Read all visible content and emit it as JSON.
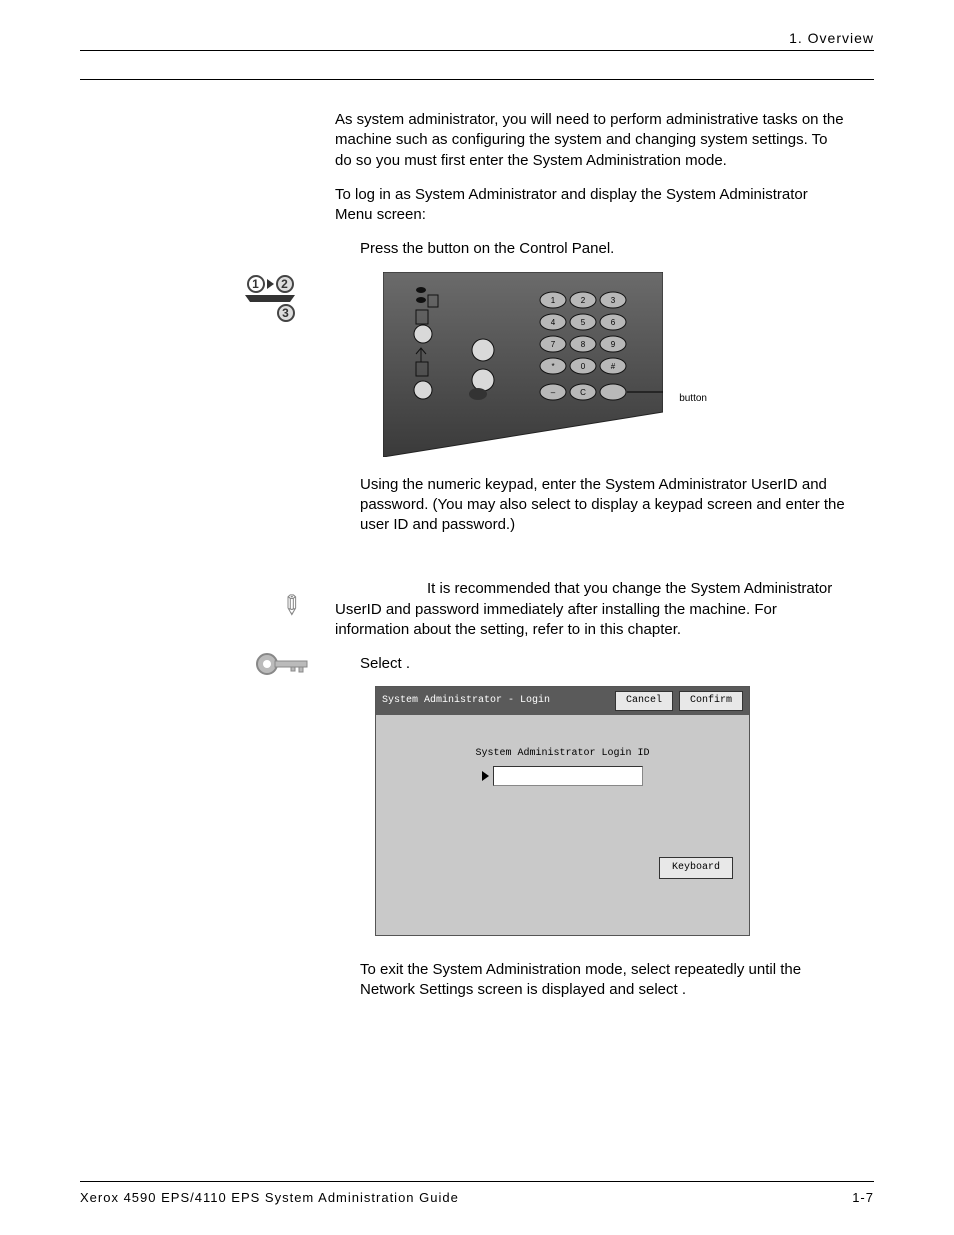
{
  "header": {
    "breadcrumb": "1. Overview"
  },
  "intro": {
    "p1": "As system administrator, you will need to perform administrative tasks on the machine such as configuring the system and changing system settings. To do so you must first enter the System Administration mode.",
    "p2": "To log in as System Administrator and display the System Administrator Menu screen:"
  },
  "step1": {
    "text_a": "Press the ",
    "text_b": " button on the Control Panel.",
    "button_label": "button"
  },
  "step2": {
    "text": "Using the numeric keypad, enter the System Administrator UserID and password.  (You may also select ",
    "text_end": " to display a keypad screen and enter the user ID and password.)"
  },
  "keypoint": {
    "text_a": "It is recommended that you change the System Administrator UserID and password immediately after installing the machine.  For information about the setting, refer to ",
    "text_b": " in this chapter."
  },
  "step3": {
    "text_a": "Select ",
    "text_b": "."
  },
  "login_dialog": {
    "title": "System Administrator - Login",
    "cancel": "Cancel",
    "confirm": "Confirm",
    "field_label": "System Administrator Login ID",
    "keyboard": "Keyboard"
  },
  "exit_note": {
    "text_a": "To exit the System Administration mode, select ",
    "text_b": " repeatedly until the Network Settings screen is displayed and select ",
    "text_c": "."
  },
  "footer": {
    "title": "Xerox 4590 EPS/4110 EPS System Administration Guide",
    "page": "1-7"
  },
  "step_icons": {
    "n1": "1",
    "n2": "2",
    "n3": "3"
  }
}
